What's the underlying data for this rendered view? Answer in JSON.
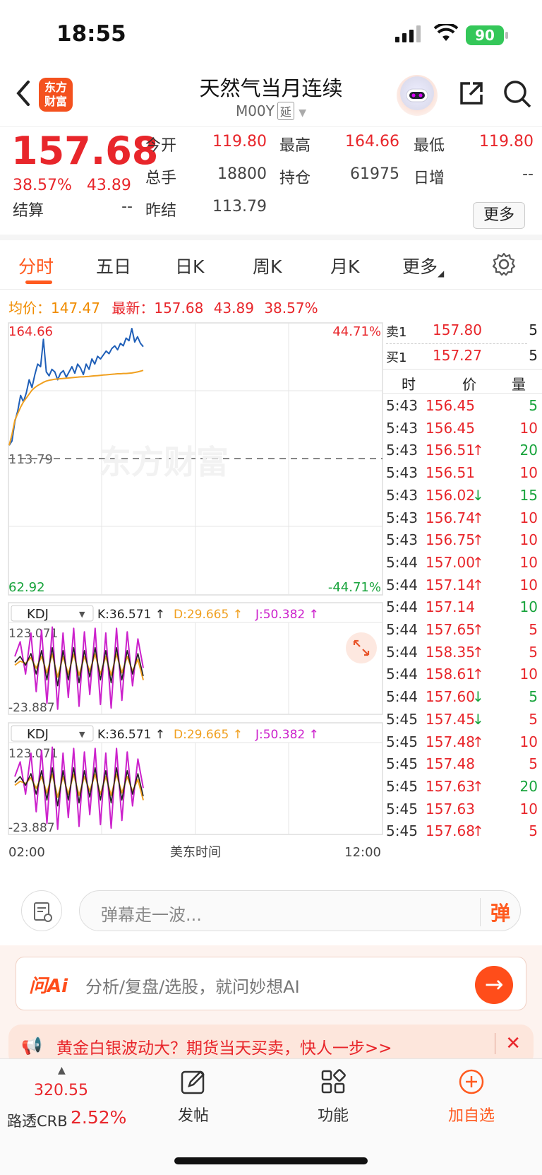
{
  "status": {
    "time": "18:55",
    "battery": "90"
  },
  "header": {
    "logo_top": "东方",
    "logo_bottom": "财富",
    "title": "天然气当月连续",
    "code": "M00Y",
    "tag": "延"
  },
  "quote": {
    "price": "157.68",
    "change_pct": "38.57%",
    "change": "43.89",
    "labels": {
      "open": "今开",
      "high": "最高",
      "low": "最低",
      "volume": "总手",
      "oi": "持仓",
      "daily_inc": "日增",
      "settle": "结算",
      "prev_settle": "昨结"
    },
    "open": "119.80",
    "high": "164.66",
    "low": "119.80",
    "volume": "18800",
    "oi": "61975",
    "daily_inc": "--",
    "settle": "--",
    "prev_settle": "113.79",
    "more_label": "更多"
  },
  "tabs": [
    "分时",
    "五日",
    "日K",
    "周K",
    "月K",
    "更多"
  ],
  "summary": {
    "avg_label": "均价：",
    "avg": "147.47",
    "latest_label": "最新：",
    "latest": "157.68",
    "chg": "43.89",
    "pct": "38.57%"
  },
  "chart": {
    "y_max": "164.66",
    "y_mid": "113.79",
    "y_min": "62.92",
    "pct_max": "44.71%",
    "pct_min": "-44.71%",
    "watermark": "东方财富",
    "x_start": "02:00",
    "x_mid": "美东时间",
    "x_end": "12:00",
    "ind1": {
      "name": "KDJ",
      "k": "K:36.571 ↑",
      "d": "D:29.665 ↑",
      "j": "J:50.382 ↑",
      "top": "123.071",
      "bottom": "-23.887"
    },
    "ind2": {
      "name": "KDJ",
      "k": "K:36.571 ↑",
      "d": "D:29.665 ↑",
      "j": "J:50.382 ↑",
      "top": "123.071",
      "bottom": "-23.887"
    }
  },
  "chart_data": {
    "type": "line",
    "y_range": [
      62.92,
      164.66
    ],
    "prev_settle": 113.79,
    "series": [
      {
        "name": "最新",
        "color": "#1f5fb8",
        "values": [
          119.8,
          121.5,
          129.0,
          133.0,
          139.0,
          136.5,
          140.0,
          145.0,
          142.0,
          147.0,
          151.0,
          150.0,
          160.5,
          148.0,
          146.5,
          149.0,
          148.0,
          145.0,
          147.5,
          148.5,
          146.0,
          148.0,
          150.0,
          147.5,
          151.0,
          149.5,
          147.0,
          151.0,
          149.0,
          153.0,
          151.0,
          154.0,
          153.0,
          154.5,
          156.0,
          155.0,
          157.0,
          158.0,
          156.5,
          159.0,
          158.0,
          161.0,
          160.0,
          164.66,
          159.5,
          161.5,
          159.0,
          157.68
        ]
      },
      {
        "name": "均价",
        "color": "#f0a020",
        "values": [
          119.8,
          124.0,
          129.5,
          132.0,
          134.5,
          136.5,
          138.0,
          139.5,
          141.0,
          142.0,
          142.8,
          143.4,
          144.0,
          144.5,
          144.8,
          145.0,
          145.2,
          145.3,
          145.4,
          145.5,
          145.6,
          145.7,
          145.8,
          145.9,
          146.0,
          146.1,
          146.1,
          146.2,
          146.3,
          146.4,
          146.5,
          146.6,
          146.7,
          146.8,
          146.9,
          147.0,
          147.1,
          147.2,
          147.3,
          147.3,
          147.4,
          147.4,
          147.5,
          147.6,
          147.8,
          148.0,
          148.3,
          148.6
        ]
      }
    ],
    "kdj_range": [
      -23.887,
      123.071
    ],
    "kdj": {
      "k": [
        60,
        70,
        55,
        75,
        40,
        80,
        30,
        85,
        20,
        80,
        30,
        85,
        25,
        80,
        35,
        85,
        30,
        80,
        25,
        85,
        30,
        80,
        40,
        75,
        36.571
      ],
      "d": [
        55,
        62,
        58,
        68,
        50,
        70,
        42,
        74,
        35,
        70,
        40,
        74,
        38,
        70,
        45,
        74,
        40,
        70,
        38,
        74,
        42,
        70,
        45,
        65,
        29.665
      ],
      "j": [
        70,
        95,
        40,
        110,
        10,
        115,
        -10,
        120,
        -20,
        110,
        0,
        118,
        -15,
        112,
        5,
        118,
        -12,
        110,
        -18,
        118,
        -5,
        112,
        20,
        100,
        50.382
      ]
    }
  },
  "orderbook": {
    "sell_label": "卖1",
    "sell_price": "157.80",
    "sell_qty": "5",
    "buy_label": "买1",
    "buy_price": "157.27",
    "buy_qty": "5",
    "col_time": "时",
    "col_price": "价",
    "col_qty": "量"
  },
  "ticks": [
    {
      "t": "5:43",
      "p": "156.45",
      "a": "",
      "q": "5",
      "qc": "green"
    },
    {
      "t": "5:43",
      "p": "156.45",
      "a": "",
      "q": "10",
      "qc": "red"
    },
    {
      "t": "5:43",
      "p": "156.51",
      "a": "↑",
      "q": "20",
      "qc": "green"
    },
    {
      "t": "5:43",
      "p": "156.51",
      "a": "",
      "q": "10",
      "qc": "red"
    },
    {
      "t": "5:43",
      "p": "156.02",
      "a": "↓",
      "q": "15",
      "qc": "green"
    },
    {
      "t": "5:43",
      "p": "156.74",
      "a": "↑",
      "q": "10",
      "qc": "red"
    },
    {
      "t": "5:43",
      "p": "156.75",
      "a": "↑",
      "q": "10",
      "qc": "red"
    },
    {
      "t": "5:44",
      "p": "157.00",
      "a": "↑",
      "q": "10",
      "qc": "red"
    },
    {
      "t": "5:44",
      "p": "157.14",
      "a": "↑",
      "q": "10",
      "qc": "red"
    },
    {
      "t": "5:44",
      "p": "157.14",
      "a": "",
      "q": "10",
      "qc": "green"
    },
    {
      "t": "5:44",
      "p": "157.65",
      "a": "↑",
      "q": "5",
      "qc": "red"
    },
    {
      "t": "5:44",
      "p": "158.35",
      "a": "↑",
      "q": "5",
      "qc": "red"
    },
    {
      "t": "5:44",
      "p": "158.61",
      "a": "↑",
      "q": "10",
      "qc": "red"
    },
    {
      "t": "5:44",
      "p": "157.60",
      "a": "↓",
      "q": "5",
      "qc": "green"
    },
    {
      "t": "5:45",
      "p": "157.45",
      "a": "↓",
      "q": "5",
      "qc": "red"
    },
    {
      "t": "5:45",
      "p": "157.48",
      "a": "↑",
      "q": "10",
      "qc": "red"
    },
    {
      "t": "5:45",
      "p": "157.48",
      "a": "",
      "q": "5",
      "qc": "red"
    },
    {
      "t": "5:45",
      "p": "157.63",
      "a": "↑",
      "q": "20",
      "qc": "green"
    },
    {
      "t": "5:45",
      "p": "157.63",
      "a": "",
      "q": "10",
      "qc": "red"
    },
    {
      "t": "5:45",
      "p": "157.68",
      "a": "↑",
      "q": "5",
      "qc": "red"
    }
  ],
  "danmu_placeholder": "弹幕走一波...",
  "danmu_icon": "弹",
  "ai": {
    "logo": "问Ai",
    "placeholder": "分析/复盘/选股，就问妙想AI"
  },
  "promo": {
    "text": "黄金白银波动大？期货当天买卖，快人一步>>"
  },
  "tabbar": {
    "crb_value": "320.55",
    "crb_name": "路透CRB",
    "crb_pct": "2.52%",
    "post": "发帖",
    "func": "功能",
    "add": "加自选"
  }
}
